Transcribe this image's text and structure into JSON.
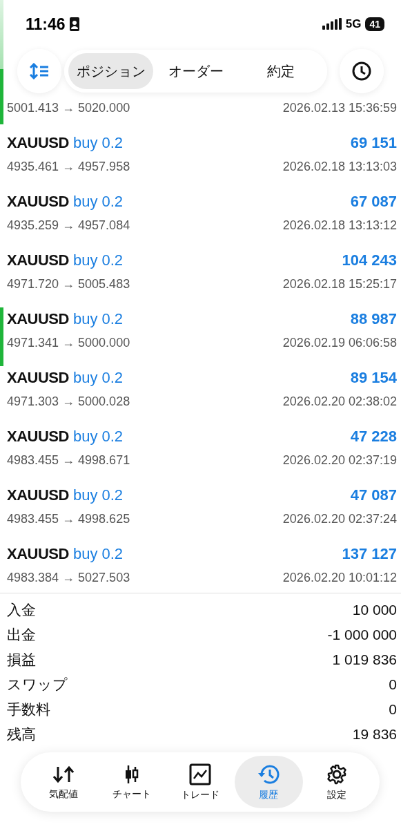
{
  "status_bar": {
    "time": "11:46",
    "network": "5G",
    "battery": "41"
  },
  "header": {
    "tabs": [
      {
        "label": "ポジション",
        "selected": true
      },
      {
        "label": "オーダー",
        "selected": false
      },
      {
        "label": "約定",
        "selected": false
      }
    ]
  },
  "deals": [
    {
      "prices": "5001.413 → 5020.000",
      "time": "2026.02.13 15:36:59",
      "marked": true
    },
    {
      "symbol": "XAUUSD",
      "side": "buy 0.2",
      "profit": "69 151",
      "prices": "4935.461 → 4957.958",
      "time": "2026.02.18 13:13:03",
      "marked": false
    },
    {
      "symbol": "XAUUSD",
      "side": "buy 0.2",
      "profit": "67 087",
      "prices": "4935.259 → 4957.084",
      "time": "2026.02.18 13:13:12",
      "marked": false
    },
    {
      "symbol": "XAUUSD",
      "side": "buy 0.2",
      "profit": "104 243",
      "prices": "4971.720 → 5005.483",
      "time": "2026.02.18 15:25:17",
      "marked": false
    },
    {
      "symbol": "XAUUSD",
      "side": "buy 0.2",
      "profit": "88 987",
      "prices": "4971.341 → 5000.000",
      "time": "2026.02.19 06:06:58",
      "marked": true
    },
    {
      "symbol": "XAUUSD",
      "side": "buy 0.2",
      "profit": "89 154",
      "prices": "4971.303 → 5000.028",
      "time": "2026.02.20 02:38:02",
      "marked": false
    },
    {
      "symbol": "XAUUSD",
      "side": "buy 0.2",
      "profit": "47 228",
      "prices": "4983.455 → 4998.671",
      "time": "2026.02.20 02:37:19",
      "marked": false
    },
    {
      "symbol": "XAUUSD",
      "side": "buy 0.2",
      "profit": "47 087",
      "prices": "4983.455 → 4998.625",
      "time": "2026.02.20 02:37:24",
      "marked": false
    },
    {
      "symbol": "XAUUSD",
      "side": "buy 0.2",
      "profit": "137 127",
      "prices": "4983.384 → 5027.503",
      "time": "2026.02.20 10:01:12",
      "marked": false
    }
  ],
  "summary": [
    {
      "label": "入金",
      "value": "10 000"
    },
    {
      "label": "出金",
      "value": "-1 000 000"
    },
    {
      "label": "損益",
      "value": "1 019 836"
    },
    {
      "label": "スワップ",
      "value": "0"
    },
    {
      "label": "手数料",
      "value": "0"
    },
    {
      "label": "残高",
      "value": "19 836"
    }
  ],
  "nav": [
    {
      "kind": "quotes",
      "label": "気配値",
      "selected": false
    },
    {
      "kind": "chart",
      "label": "チャート",
      "selected": false
    },
    {
      "kind": "trade",
      "label": "トレード",
      "selected": false
    },
    {
      "kind": "history",
      "label": "履歴",
      "selected": true
    },
    {
      "kind": "settings",
      "label": "設定",
      "selected": false
    }
  ]
}
